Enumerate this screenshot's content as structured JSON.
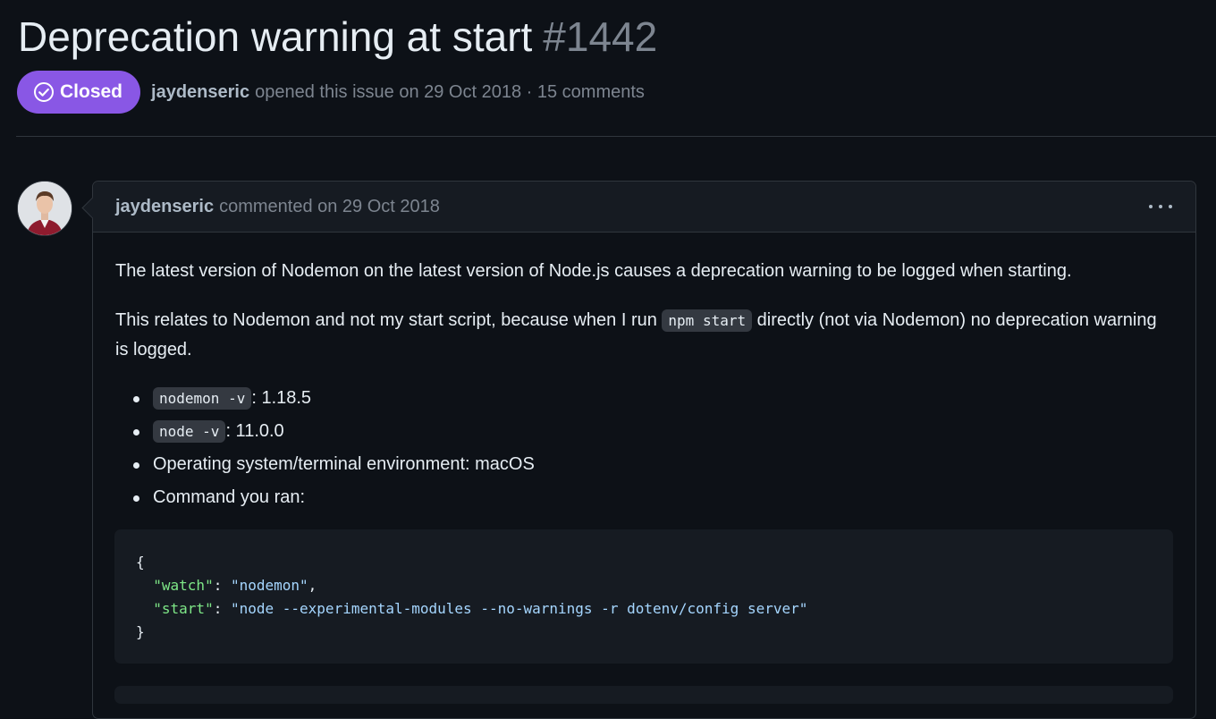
{
  "issue": {
    "title": "Deprecation warning at start",
    "number": "#1442",
    "status": "Closed",
    "status_color": "#8957e5",
    "author": "jaydenseric",
    "meta": "opened this issue on 29 Oct 2018 · 15 comments"
  },
  "comment": {
    "author": "jaydenseric",
    "meta": "commented on 29 Oct 2018",
    "menu_icon": "kebab-horizontal-icon",
    "p1": "The latest version of Nodemon on the latest version of Node.js causes a deprecation warning to be logged when starting.",
    "p2_before": "This relates to Nodemon and not my start script, because when I run ",
    "p2_code": "npm start",
    "p2_after": " directly (not via Nodemon) no deprecation warning is logged.",
    "env": [
      {
        "code": "nodemon -v",
        "text": ": 1.18.5"
      },
      {
        "code": "node -v",
        "text": ": 11.0.0"
      },
      {
        "code": "",
        "text": "Operating system/terminal environment: macOS"
      },
      {
        "code": "",
        "text": "Command you ran:"
      }
    ],
    "code": {
      "open": "{",
      "line1_key": "\"watch\"",
      "line1_sep": ": ",
      "line1_val": "\"nodemon\"",
      "line1_end": ",",
      "line2_key": "\"start\"",
      "line2_sep": ": ",
      "line2_val": "\"node --experimental-modules --no-warnings -r dotenv/config server\"",
      "close": "}"
    }
  }
}
